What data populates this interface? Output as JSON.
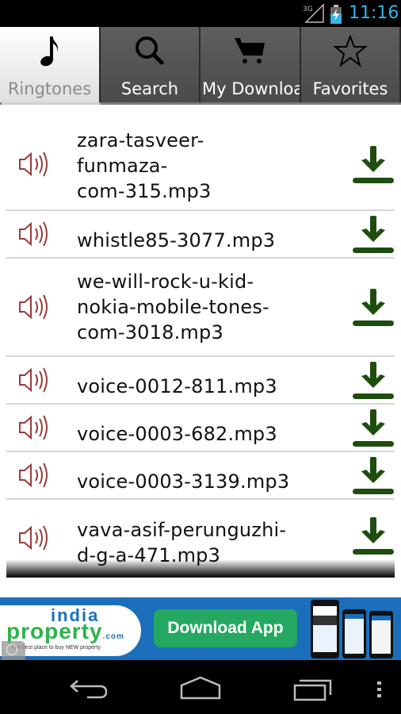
{
  "status_bar": {
    "network": "3G",
    "time": "11:16",
    "clock_color": "#33b5e5"
  },
  "tabs": [
    {
      "label": "Ringtones",
      "icon": "music-note-icon",
      "active": true
    },
    {
      "label": "Search",
      "icon": "search-icon",
      "active": false
    },
    {
      "label": "My Downloads",
      "icon": "cart-icon",
      "active": false
    },
    {
      "label": "Favorites",
      "icon": "star-icon",
      "active": false
    }
  ],
  "ringtones": [
    {
      "name": "zara-tasveer-funmaza-com-315.mp3",
      "lines": [
        "zara-tasveer-",
        "funmaza-",
        "com-315.mp3"
      ]
    },
    {
      "name": "whistle85-3077.mp3",
      "lines": [
        "whistle85-3077.mp3"
      ]
    },
    {
      "name": "we-will-rock-u-kid-nokia-mobile-tones-com-3018.mp3",
      "lines": [
        "we-will-rock-u-kid-",
        "nokia-mobile-tones-",
        "com-3018.mp3"
      ]
    },
    {
      "name": "voice-0012-811.mp3",
      "lines": [
        "voice-0012-811.mp3"
      ]
    },
    {
      "name": "voice-0003-682.mp3",
      "lines": [
        "voice-0003-682.mp3"
      ]
    },
    {
      "name": "voice-0003-3139.mp3",
      "lines": [
        "voice-0003-3139.mp3"
      ]
    },
    {
      "name": "vava-asif-perunguzhi-d-g-a-471.mp3",
      "lines": [
        "vava-asif-perunguzhi-",
        "d-g-a-471.mp3"
      ]
    }
  ],
  "icons": {
    "play": "speaker-icon",
    "download": "download-icon",
    "speaker_color": "#9b3a3a",
    "download_color": "#1f4d0f"
  },
  "ad": {
    "brand_top": "india",
    "brand_bottom": "property",
    "brand_suffix": ".com",
    "tagline": "The best place to buy NEW property",
    "cta": "Download App",
    "bg_color": "#1b6fba",
    "cta_color": "#25a962"
  },
  "navbar": {
    "back": "back-icon",
    "home": "home-icon",
    "recents": "recents-icon",
    "menu": "overflow-menu-icon"
  }
}
